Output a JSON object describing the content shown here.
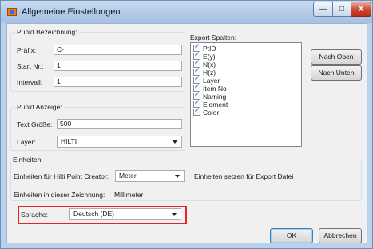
{
  "window": {
    "title": "Allgemeine Einstellungen",
    "minimize_glyph": "—",
    "maximize_glyph": "□",
    "close_glyph": "X"
  },
  "punkt_bezeichnung": {
    "group_label": "Punkt Bezeichnung:",
    "praefix_label": "Präfix:",
    "praefix_value": "C-",
    "startnr_label": "Start Nr.:",
    "startnr_value": "1",
    "intervall_label": "Intervall:",
    "intervall_value": "1"
  },
  "export_spalten": {
    "group_label": "Export Spalten:",
    "items": [
      {
        "label": "PtID",
        "checked": true
      },
      {
        "label": "E(y)",
        "checked": true
      },
      {
        "label": "N(x)",
        "checked": true
      },
      {
        "label": "H(z)",
        "checked": true
      },
      {
        "label": "Layer",
        "checked": true
      },
      {
        "label": "Item No",
        "checked": true
      },
      {
        "label": "Naming",
        "checked": true
      },
      {
        "label": "Element",
        "checked": true
      },
      {
        "label": "Color",
        "checked": true
      }
    ],
    "nach_oben_label": "Nach Oben",
    "nach_unten_label": "Nach Unten"
  },
  "punkt_anzeige": {
    "group_label": "Punkt Anzeige:",
    "textgroesse_label": "Text Größe:",
    "textgroesse_value": "500",
    "layer_label": "Layer:",
    "layer_value": "HILTI"
  },
  "einheiten": {
    "group_label": "Einheiten:",
    "creator_label": "Einheiten für Hilti Point Creator:",
    "creator_value": "Meter",
    "export_label": "Einheiten setzen für Export Datei",
    "zeichnung_label": "Einheiten in dieser Zeichnung:",
    "zeichnung_value": "Millimeter"
  },
  "sprache": {
    "label": "Sprache:",
    "value": "Deutsch (DE)",
    "highlight_color": "#e0262a"
  },
  "footer": {
    "ok_label": "OK",
    "abbrechen_label": "Abbrechen"
  }
}
